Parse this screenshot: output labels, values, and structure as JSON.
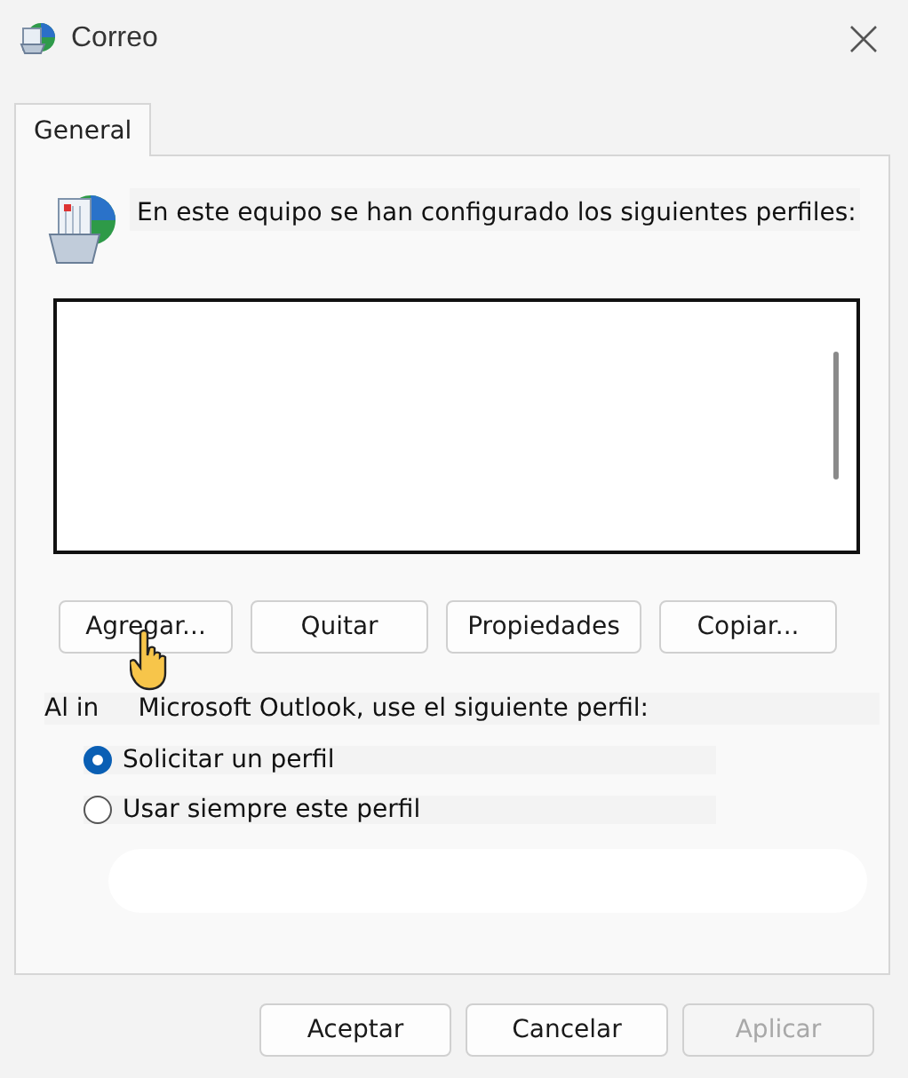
{
  "window": {
    "title": "Correo"
  },
  "tabs": [
    {
      "label": "General",
      "selected": true
    }
  ],
  "intro": "En este equipo se han configurado los siguientes perfiles:",
  "profile_buttons": [
    {
      "label": "Agregar..."
    },
    {
      "label": "Quitar"
    },
    {
      "label": "Propiedades"
    },
    {
      "label": "Copiar..."
    }
  ],
  "startup_label": {
    "before_cursor": "Al in",
    "after_cursor": "Microsoft Outlook, use el siguiente perfil:"
  },
  "options": [
    {
      "label": "Solicitar un perfil",
      "selected": true
    },
    {
      "label": "Usar siempre este perfil",
      "selected": false
    }
  ],
  "footer_buttons": [
    {
      "label": "Aceptar",
      "disabled": false
    },
    {
      "label": "Cancelar",
      "disabled": false
    },
    {
      "label": "Aplicar",
      "disabled": true
    }
  ]
}
